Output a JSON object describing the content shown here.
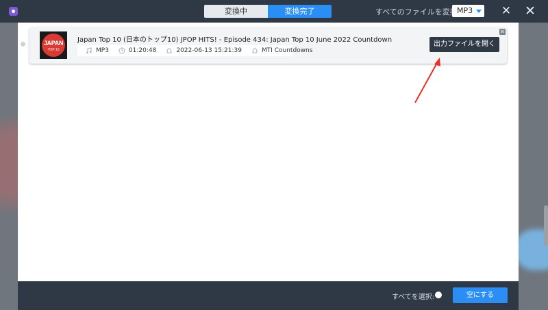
{
  "tabs": [
    {
      "label": "変換中",
      "active": false
    },
    {
      "label": "変換完了",
      "active": true
    }
  ],
  "header": {
    "convert_all_label": "すべてのファイルを変換:",
    "format_value": "MP3"
  },
  "item": {
    "title": "Japan Top 10 (日本のトップ10) JPOP HITS! - Episode 434: Japan Top 10 June 2022 Countdown",
    "thumbnail_text": "JAPAN",
    "thumbnail_subtext": "TOP 10",
    "format": "MP3",
    "duration": "01:20:48",
    "date": "2022-06-13 15:21:39",
    "author": "MTI Countdowns",
    "open_output_label": "出力ファイルを開く"
  },
  "footer": {
    "select_all_label": "すべてを選択:",
    "empty_label": "空にする"
  },
  "colors": {
    "accent": "#2a8ef5",
    "dark": "#2f3845",
    "arrow": "#e8302a"
  },
  "icons": [
    "app-icon",
    "close-icon",
    "music-icon",
    "clock-icon",
    "calendar-icon",
    "user-icon",
    "remove-icon"
  ]
}
